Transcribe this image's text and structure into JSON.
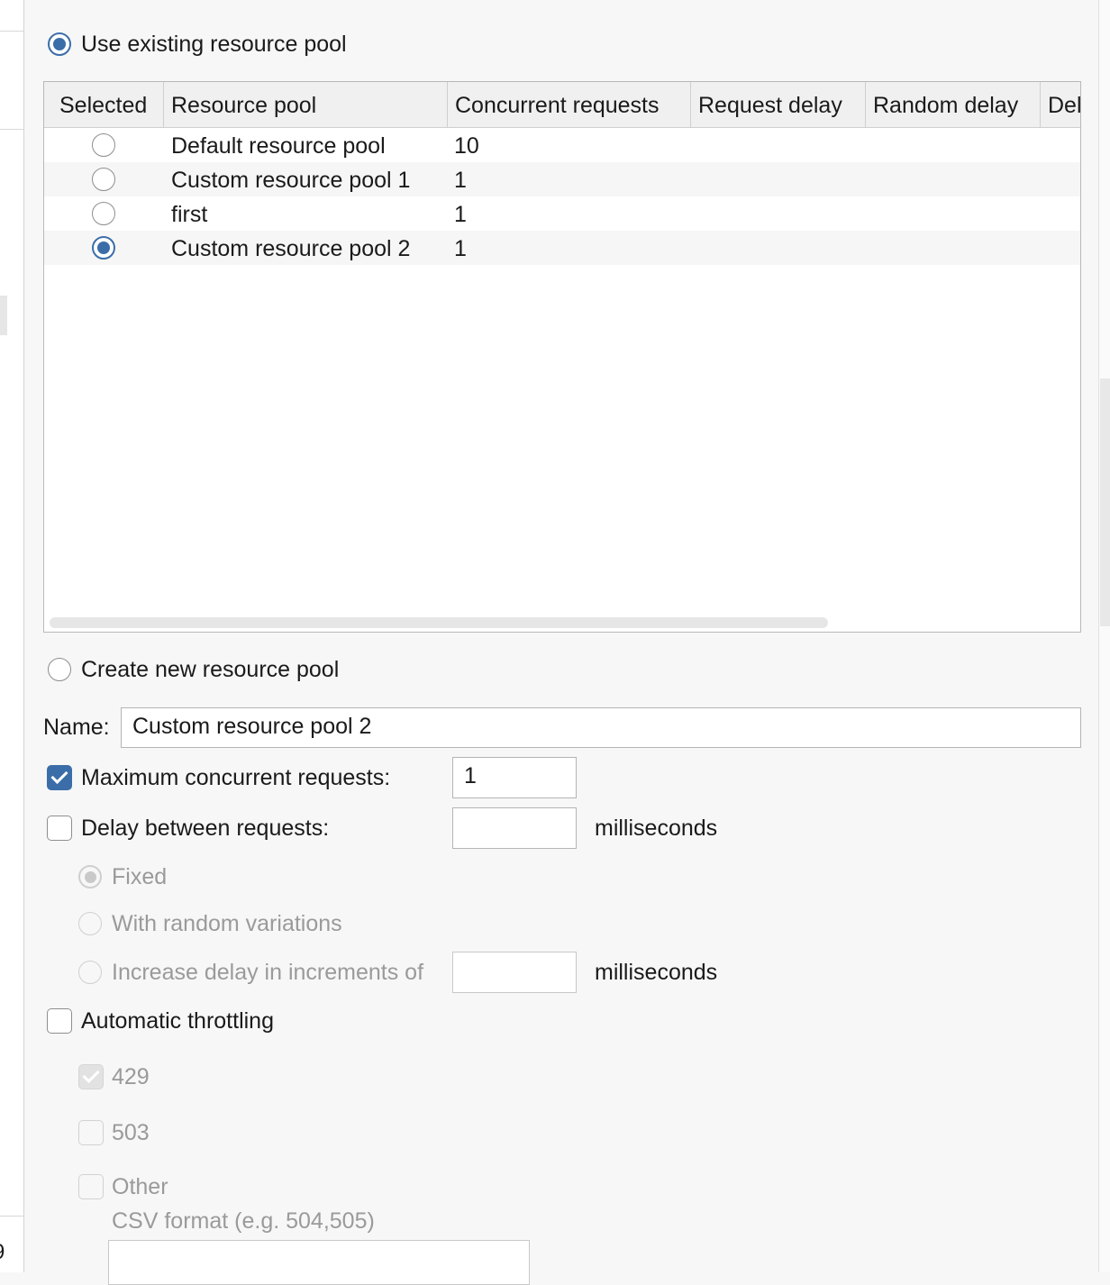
{
  "pool_selection": {
    "use_existing_label": "Use existing resource pool",
    "use_existing_selected": true,
    "create_new_label": "Create new resource pool",
    "create_new_selected": false
  },
  "pool_table": {
    "columns": [
      "Selected",
      "Resource pool",
      "Concurrent requests",
      "Request delay",
      "Random delay",
      "Del"
    ],
    "rows": [
      {
        "selected": false,
        "name": "Default resource pool",
        "concurrent": "10",
        "request_delay": "",
        "random_delay": ""
      },
      {
        "selected": false,
        "name": "Custom resource pool 1",
        "concurrent": "1",
        "request_delay": "",
        "random_delay": ""
      },
      {
        "selected": false,
        "name": "first",
        "concurrent": "1",
        "request_delay": "",
        "random_delay": ""
      },
      {
        "selected": true,
        "name": "Custom resource pool 2",
        "concurrent": "1",
        "request_delay": "",
        "random_delay": ""
      }
    ]
  },
  "new_pool": {
    "name_label": "Name:",
    "name_value": "Custom resource pool 2",
    "max_concurrent": {
      "label": "Maximum concurrent requests:",
      "checked": true,
      "value": "1"
    },
    "delay": {
      "label": "Delay between requests:",
      "checked": false,
      "value": "",
      "unit": "milliseconds",
      "options": {
        "fixed": {
          "label": "Fixed",
          "selected": true
        },
        "random": {
          "label": "With random variations",
          "selected": false
        },
        "increase": {
          "label": "Increase delay in increments of",
          "selected": false,
          "value": "",
          "unit": "milliseconds"
        }
      }
    },
    "throttling": {
      "label": "Automatic throttling",
      "checked": false,
      "codes": [
        {
          "label": "429",
          "checked": true
        },
        {
          "label": "503",
          "checked": false
        },
        {
          "label": "Other",
          "checked": false
        }
      ],
      "other_hint": "CSV format (e.g. 504,505)",
      "other_value": ""
    }
  },
  "sidebar": {
    "partial_digit": "9"
  },
  "colors": {
    "accent": "#3b6ea8",
    "disabled_text": "#9a9a9a",
    "background": "#f7f7f7"
  }
}
